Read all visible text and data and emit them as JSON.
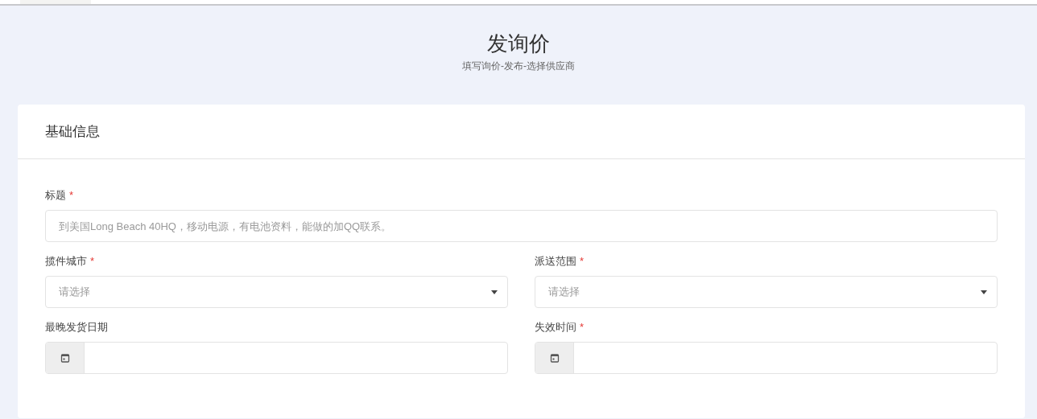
{
  "header": {
    "title": "发询价",
    "subtitle": "填写询价-发布-选择供应商"
  },
  "card": {
    "title": "基础信息",
    "fields": [
      {
        "kind": "text",
        "label": "标题",
        "asterisk": "*",
        "placeholder": "到美国Long Beach 40HQ，移动电源，有电池资料，能做的加QQ联系。"
      },
      {
        "kind": "select",
        "label": "揽件城市",
        "asterisk": "*",
        "placeholder": "请选择"
      },
      {
        "kind": "select",
        "label": "派送范围",
        "asterisk": "*",
        "placeholder": "请选择"
      },
      {
        "kind": "date",
        "label": "最晚发货日期"
      },
      {
        "kind": "date",
        "label": "失效时间",
        "asterisk": "*"
      }
    ]
  }
}
